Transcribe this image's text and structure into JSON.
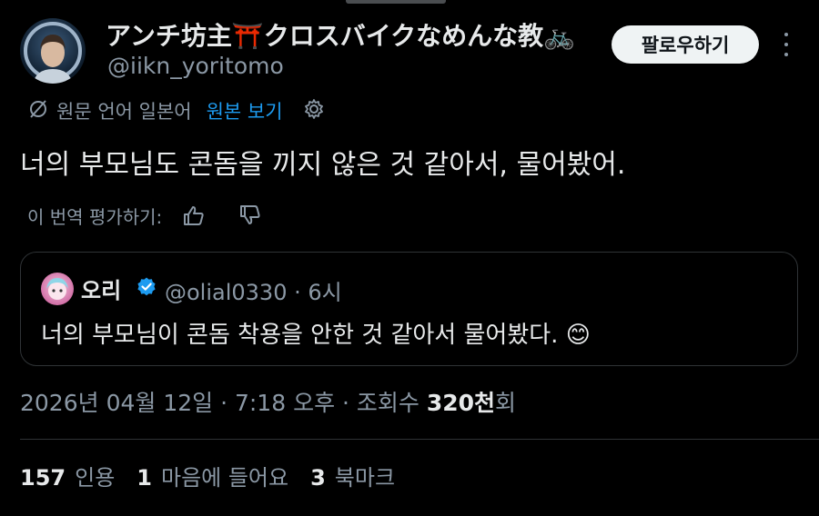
{
  "author": {
    "display_name": "アンチ坊主⛩️クロスバイクなめんな教🚲",
    "handle": "@iikn_yoritomo",
    "follow_label": "팔로우하기"
  },
  "translation": {
    "source_label": "원문 언어 일본어",
    "show_original": "원본 보기"
  },
  "tweet": {
    "text": "너의 부모님도 콘돔을 끼지 않은 것 같아서, 물어봤어.",
    "rate_label": "이 번역 평가하기:"
  },
  "quote": {
    "name": "오리",
    "handle_time": "@olial0330 · 6시",
    "text": "너의 부모님이 콘돔 착용을 안한 것 같아서 물어봤다. 😊"
  },
  "meta": {
    "timestamp": "2026년 04월 12일 · 7:18 오후 · 조회수 ",
    "views_number": "320천",
    "views_suffix": "회"
  },
  "stats": {
    "quotes_count": "157",
    "quotes_label": "인용",
    "likes_count": "1",
    "likes_label": "마음에 들어요",
    "bookmarks_count": "3",
    "bookmarks_label": "북마크"
  },
  "colors": {
    "background": "#000000",
    "text_primary": "#e7e9ea",
    "text_secondary": "#8b98a5",
    "link_blue": "#1d9bf0",
    "border": "#2f3336"
  }
}
